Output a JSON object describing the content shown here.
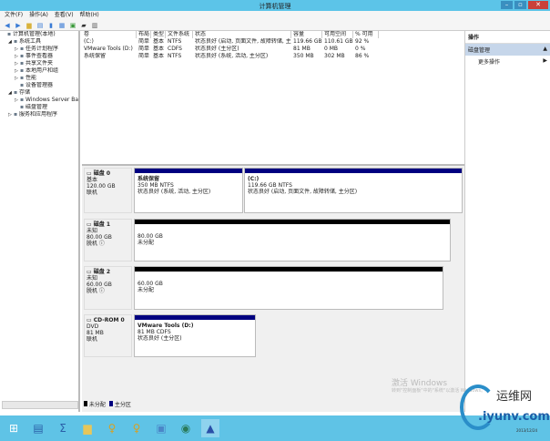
{
  "window": {
    "title": "计算机管理",
    "minimize": "–",
    "maximize": "▫",
    "close": "✕"
  },
  "menu": [
    "文件(F)",
    "操作(A)",
    "查看(V)",
    "帮助(H)"
  ],
  "toolbar": [
    "back-icon",
    "forward-icon",
    "folder-icon",
    "console-icon",
    "help-icon",
    "view-icon",
    "properties-icon",
    "export-icon",
    "refresh-icon"
  ],
  "tree": [
    {
      "label": "计算机管理(本地)",
      "indent": 0,
      "arrow": ""
    },
    {
      "label": "系统工具",
      "indent": 1,
      "arrow": "◢"
    },
    {
      "label": "任务计划程序",
      "indent": 2,
      "arrow": "▷"
    },
    {
      "label": "事件查看器",
      "indent": 2,
      "arrow": "▷"
    },
    {
      "label": "共享文件夹",
      "indent": 2,
      "arrow": "▷"
    },
    {
      "label": "本地用户和组",
      "indent": 2,
      "arrow": "▷"
    },
    {
      "label": "性能",
      "indent": 2,
      "arrow": "▷"
    },
    {
      "label": "设备管理器",
      "indent": 2,
      "arrow": ""
    },
    {
      "label": "存储",
      "indent": 1,
      "arrow": "◢"
    },
    {
      "label": "Windows Server Back",
      "indent": 2,
      "arrow": "▷"
    },
    {
      "label": "磁盘管理",
      "indent": 2,
      "arrow": ""
    },
    {
      "label": "服务和应用程序",
      "indent": 1,
      "arrow": "▷"
    }
  ],
  "volumes": {
    "columns": [
      "卷",
      "布局",
      "类型",
      "文件系统",
      "状态",
      "容量",
      "可用空间",
      "% 可用"
    ],
    "rows": [
      [
        "(C:)",
        "简单",
        "基本",
        "NTFS",
        "状态良好 (启动, 页面文件, 故障转储, 主分区)",
        "119.66 GB",
        "110.61 GB",
        "92 %"
      ],
      [
        "VMware Tools (D:)",
        "简单",
        "基本",
        "CDFS",
        "状态良好 (主分区)",
        "81 MB",
        "0 MB",
        "0 %"
      ],
      [
        "系统保留",
        "简单",
        "基本",
        "NTFS",
        "状态良好 (系统, 活动, 主分区)",
        "350 MB",
        "302 MB",
        "86 %"
      ]
    ]
  },
  "disks": [
    {
      "name": "磁盘 0",
      "type": "基本",
      "size": "120.00 GB",
      "status": "联机",
      "partitions": [
        {
          "title": "系统保留",
          "size": "350 MB NTFS",
          "status": "状态良好 (系统, 活动, 主分区)",
          "kind": "primary"
        },
        {
          "title": "(C:)",
          "size": "119.66 GB NTFS",
          "status": "状态良好 (启动, 页面文件, 故障转储, 主分区)",
          "kind": "primary"
        }
      ]
    },
    {
      "name": "磁盘 1",
      "type": "未知",
      "size": "80.00 GB",
      "status": "脱机 ⓘ",
      "partitions": [
        {
          "title": "",
          "size": "80.00 GB",
          "status": "未分配",
          "kind": "unallocated"
        }
      ]
    },
    {
      "name": "磁盘 2",
      "type": "未知",
      "size": "60.00 GB",
      "status": "脱机 ⓘ",
      "partitions": [
        {
          "title": "",
          "size": "60.00 GB",
          "status": "未分配",
          "kind": "unallocated"
        }
      ]
    },
    {
      "name": "CD-ROM 0",
      "type": "DVD",
      "size": "81 MB",
      "status": "联机",
      "partitions": [
        {
          "title": "VMware Tools (D:)",
          "size": "81 MB CDFS",
          "status": "状态良好 (主分区)",
          "kind": "primary"
        }
      ]
    }
  ],
  "legend": [
    {
      "label": "未分配",
      "color": "#000000"
    },
    {
      "label": "主分区",
      "color": "#000080"
    }
  ],
  "actions": {
    "header": "操作",
    "section": "磁盘管理",
    "more": "更多操作"
  },
  "watermark": {
    "line1": "激活 Windows",
    "line2": "转到\"控制面板\"中的\"系统\"以激活 Windows。",
    "logo": "运维网 iyunv.com",
    "date": "2013/12/24"
  },
  "taskbar": [
    "start-icon",
    "server-manager-icon",
    "powershell-icon",
    "explorer-icon",
    "disk-tool-icon",
    "disk-tool-icon-2",
    "remote-desktop-icon",
    "network-icon",
    "computer-management-icon"
  ],
  "colors": {
    "titlebar": "#5cc4e8",
    "primary": "#000080",
    "unallocated": "#000000",
    "taskbar": "#5fc3e6"
  }
}
